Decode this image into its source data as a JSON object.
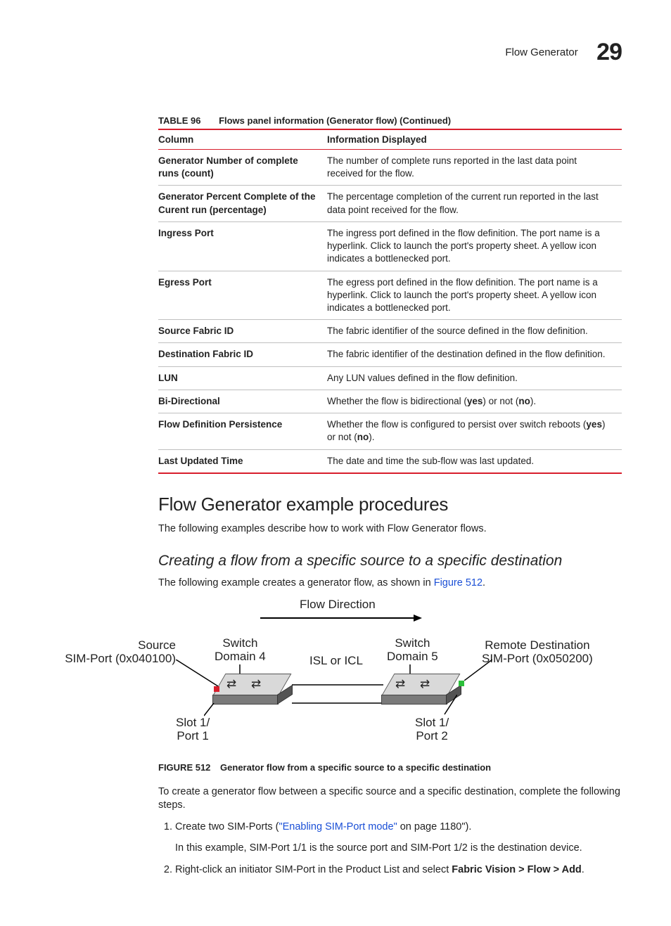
{
  "header": {
    "section": "Flow Generator",
    "chapter": "29"
  },
  "table": {
    "label": "TABLE 96",
    "title": "Flows panel information (Generator flow) (Continued)",
    "head": {
      "c1": "Column",
      "c2": "Information Displayed"
    },
    "rows": [
      {
        "col": "Generator Number of complete runs (count)",
        "info": "The number of  complete runs reported in the last data point received for the flow."
      },
      {
        "col": "Generator Percent Complete of the Curent run (percentage)",
        "info": "The percentage completion of the current run reported in the last data point received for the flow."
      },
      {
        "col": "Ingress Port",
        "info": "The ingress port defined in the flow definition. The port name is a hyperlink. Click to launch the port's property sheet. A yellow icon indicates a bottlenecked port."
      },
      {
        "col": "Egress Port",
        "info": "The egress port defined in the flow definition. The port name is a hyperlink. Click to launch the port's property sheet. A yellow icon indicates a bottlenecked port."
      },
      {
        "col": "Source Fabric ID",
        "info": "The fabric identifier of the source defined in the flow definition."
      },
      {
        "col": "Destination Fabric ID",
        "info": "The fabric identifier of the destination defined in the flow definition."
      },
      {
        "col": "LUN",
        "info": "Any LUN values defined in the flow definition."
      },
      {
        "col": "Bi-Directional",
        "info_pre": "Whether the flow is bidirectional (",
        "info_b1": "yes",
        "info_mid": ") or not (",
        "info_b2": "no",
        "info_post": ")."
      },
      {
        "col": "Flow Definition Persistence",
        "info_pre": "Whether the flow is configured to persist over switch reboots (",
        "info_b1": "yes",
        "info_mid": ") or not (",
        "info_b2": "no",
        "info_post": ")."
      },
      {
        "col": "Last Updated Time",
        "info": "The date and time the sub-flow was last updated."
      }
    ]
  },
  "h2": "Flow Generator example procedures",
  "p1": "The following examples describe how to work with Flow Generator flows.",
  "h3": "Creating a flow from a specific source to a specific destination",
  "p2_pre": "The following example creates a generator flow, as shown in ",
  "p2_link": "Figure 512",
  "p2_post": ".",
  "diagram": {
    "flowdir": "Flow Direction",
    "source_l1": "Source",
    "source_l2": "SIM-Port (0x040100)",
    "slot1": "Slot 1/\nPort 1",
    "sw4_l1": "Switch",
    "sw4_l2": "Domain 4",
    "isl": "ISL or ICL",
    "sw5_l1": "Switch",
    "sw5_l2": "Domain 5",
    "slot2": "Slot 1/\nPort 2",
    "dest_l1": "Remote Destination",
    "dest_l2": "SIM-Port (0x050200)"
  },
  "figure": {
    "label": "FIGURE 512",
    "title": "Generator flow from a specific source to a specific destination"
  },
  "p3": "To create a generator flow between a specific source and a specific destination, complete the following steps.",
  "steps": {
    "s1_pre": "Create two SIM-Ports (",
    "s1_link": "\"Enabling SIM-Port mode\"",
    "s1_post": " on page 1180\").",
    "s1_sub": "In this example, SIM-Port 1/1 is the source port and SIM-Port 1/2 is the destination device.",
    "s2_pre": "Right-click an initiator SIM-Port in the Product List and select ",
    "s2_b": "Fabric Vision > Flow > Add",
    "s2_post": "."
  }
}
